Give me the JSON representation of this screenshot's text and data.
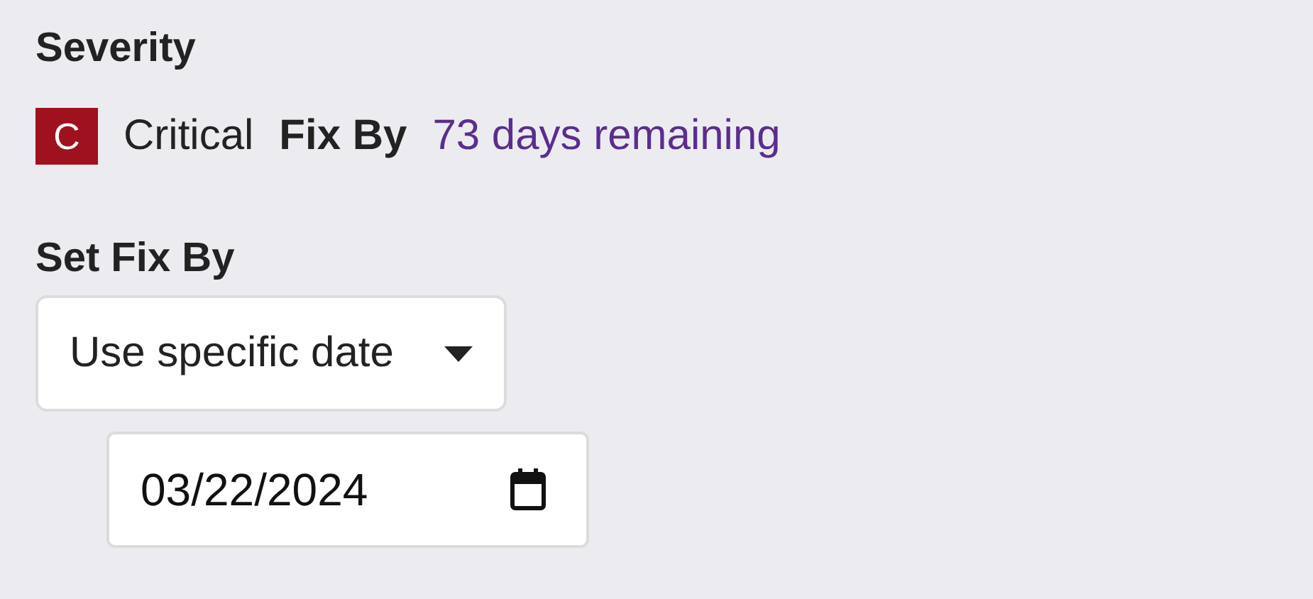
{
  "severity": {
    "heading": "Severity",
    "badge": {
      "letter": "C",
      "color": "#a0111f"
    },
    "level_text": "Critical",
    "fix_by_label": "Fix By",
    "fix_by_value": "73 days remaining"
  },
  "set_fix_by": {
    "heading": "Set Fix By",
    "dropdown": {
      "value": "Use specific date"
    },
    "date_field": {
      "value": "03/22/2024"
    }
  }
}
